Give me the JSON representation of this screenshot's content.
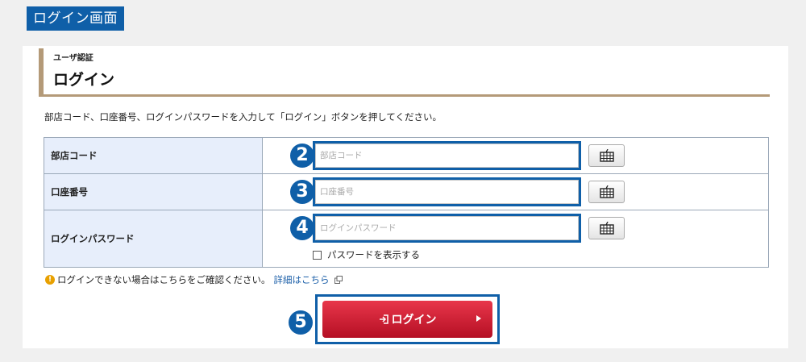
{
  "page_title": "ログイン画面",
  "heading": {
    "small": "ユーザ認証",
    "big": "ログイン"
  },
  "intro": "部店コード、口座番号、ログインパスワードを入力して「ログイン」ボタンを押してください。",
  "fields": [
    {
      "label": "部店コード",
      "badge": "2",
      "placeholder": "部店コード",
      "value": ""
    },
    {
      "label": "口座番号",
      "badge": "3",
      "placeholder": "口座番号",
      "value": ""
    },
    {
      "label": "ログインパスワード",
      "badge": "4",
      "placeholder": "ログインパスワード",
      "value": ""
    }
  ],
  "show_password_label": "パスワードを表示する",
  "notice": {
    "text": "ログインできない場合はこちらをご確認ください。",
    "link": "詳細はこちら"
  },
  "login": {
    "badge": "5",
    "label": "ログイン"
  },
  "colors": {
    "accent_blue": "#0f5fa8",
    "login_red": "#cc1f33",
    "heading_rule": "#b49a78",
    "label_bg": "#e7eefb",
    "warning": "#e8a000"
  },
  "icons": {
    "keyboard": "keyboard-icon",
    "warning": "warning-icon",
    "external": "external-link-icon",
    "login": "login-icon",
    "arrow": "arrow-right-icon"
  }
}
